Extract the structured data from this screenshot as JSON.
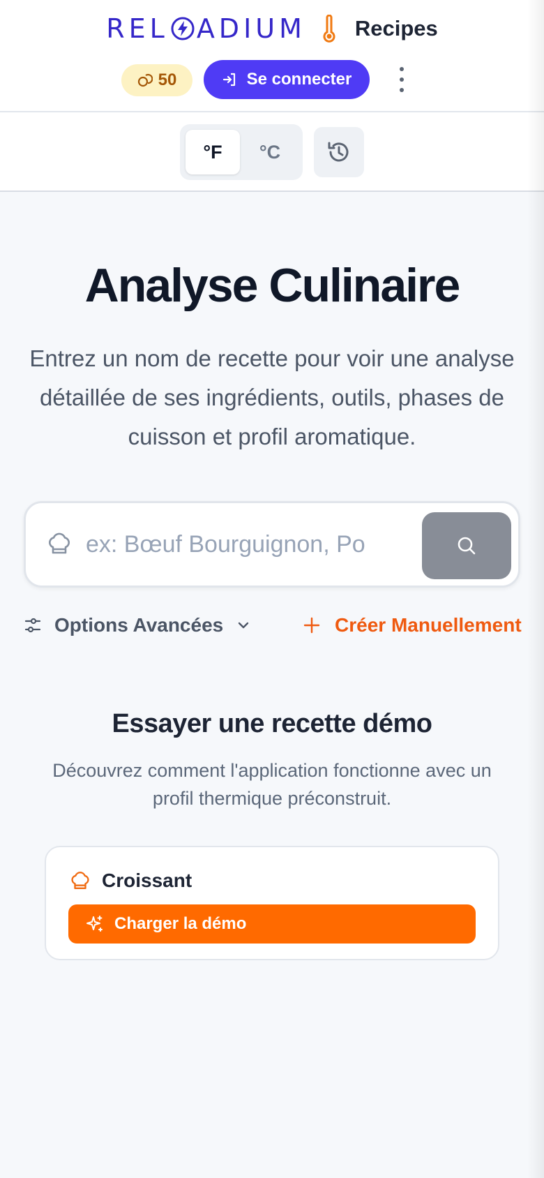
{
  "header": {
    "brand_name": "RELOADIUM",
    "brand_prefix": "REL",
    "brand_suffix": "ADIUM",
    "section_label": "Recipes",
    "credits": "50",
    "login_label": "Se connecter",
    "menu_icon": "more-vertical-icon"
  },
  "toolbar": {
    "units": [
      {
        "label": "°F",
        "active": true
      },
      {
        "label": "°C",
        "active": false
      }
    ],
    "history_icon": "history-icon"
  },
  "main": {
    "title": "Analyse Culinaire",
    "subtitle": "Entrez un nom de recette pour voir une analyse détaillée de ses ingrédients, outils, phases de cuisson et profil aromatique.",
    "search": {
      "placeholder": "ex: Bœuf Bourguignon, Poulet rôti",
      "value": ""
    },
    "options_label": "Options Avancées",
    "create_label": "Créer Manuellement"
  },
  "demo": {
    "title": "Essayer une recette démo",
    "description": "Découvrez comment l'application fonctionne avec un profil thermique préconstruit.",
    "recipe_name": "Croissant",
    "button_label": "Charger la démo"
  },
  "colors": {
    "brand": "#3527c9",
    "primary": "#4f3bf5",
    "accent": "#ff6a00",
    "credits_bg": "#fdf2c3"
  }
}
